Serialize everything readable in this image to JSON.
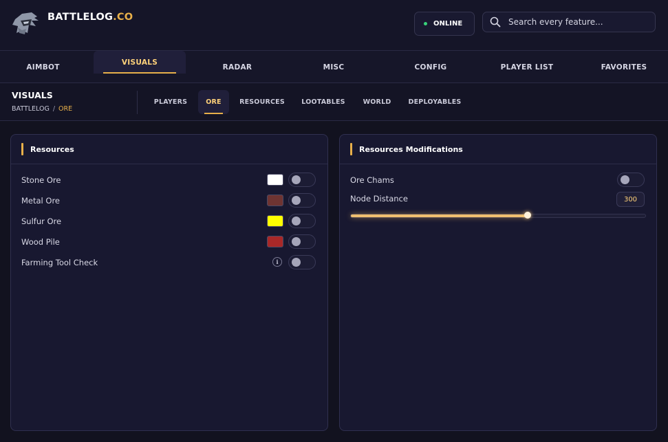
{
  "brand": {
    "name": "BATTLELOG",
    "suffix": ".CO",
    "accent_color": "#e8b04a"
  },
  "status": {
    "label": "ONLINE",
    "color": "#39d37a"
  },
  "search": {
    "placeholder": "Search every feature..."
  },
  "main_tabs": [
    {
      "label": "AIMBOT",
      "active": false
    },
    {
      "label": "VISUALS",
      "active": true
    },
    {
      "label": "RADAR",
      "active": false
    },
    {
      "label": "MISC",
      "active": false
    },
    {
      "label": "CONFIG",
      "active": false
    },
    {
      "label": "PLAYER LIST",
      "active": false
    },
    {
      "label": "FAVORITES",
      "active": false
    }
  ],
  "section": {
    "title": "VISUALS",
    "breadcrumb": {
      "root": "BATTLELOG",
      "separator": "/",
      "current": "ORE"
    }
  },
  "sub_tabs": [
    {
      "label": "PLAYERS",
      "active": false
    },
    {
      "label": "ORE",
      "active": true
    },
    {
      "label": "RESOURCES",
      "active": false
    },
    {
      "label": "LOOTABLES",
      "active": false
    },
    {
      "label": "WORLD",
      "active": false
    },
    {
      "label": "DEPLOYABLES",
      "active": false
    }
  ],
  "resources_panel": {
    "title": "Resources",
    "items": [
      {
        "label": "Stone Ore",
        "color": "#ffffff",
        "enabled": false
      },
      {
        "label": "Metal Ore",
        "color": "#6e3432",
        "enabled": false
      },
      {
        "label": "Sulfur Ore",
        "color": "#ffff00",
        "enabled": false
      },
      {
        "label": "Wood Pile",
        "color": "#a82828",
        "enabled": false
      },
      {
        "label": "Farming Tool Check",
        "info_icon": "i",
        "enabled": false
      }
    ]
  },
  "modifications_panel": {
    "title": "Resources Modifications",
    "ore_chams": {
      "label": "Ore Chams",
      "enabled": false
    },
    "node_distance": {
      "label": "Node Distance",
      "value": "300",
      "fraction": 0.6
    }
  }
}
